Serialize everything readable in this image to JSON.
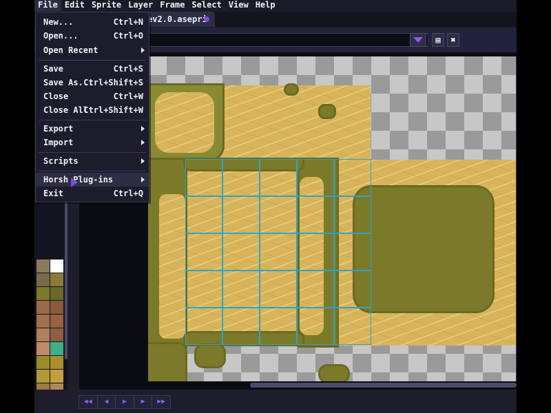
{
  "menubar": {
    "items": [
      "File",
      "Edit",
      "Sprite",
      "Layer",
      "Frame",
      "Select",
      "View",
      "Help"
    ]
  },
  "tab": {
    "title": "ev2.0.asepri"
  },
  "file_menu": {
    "items": [
      {
        "label": "New...",
        "shortcut": "Ctrl+N"
      },
      {
        "label": "Open...",
        "shortcut": "Ctrl+O"
      },
      {
        "label": "Open Recent",
        "submenu": true
      },
      {
        "label": "Save",
        "shortcut": "Ctrl+S"
      },
      {
        "label": "Save As...",
        "shortcut": "Ctrl+Shift+S"
      },
      {
        "label": "Close",
        "shortcut": "Ctrl+W"
      },
      {
        "label": "Close All",
        "shortcut": "Ctrl+Shift+W"
      },
      {
        "label": "Export",
        "submenu": true
      },
      {
        "label": "Import",
        "submenu": true
      },
      {
        "label": "Scripts",
        "submenu": true
      },
      {
        "label": "Horsh Plug-ins",
        "submenu": true
      },
      {
        "label": "Exit",
        "shortcut": "Ctrl+Q"
      }
    ]
  },
  "colors": {
    "accent": "#7a4cd8",
    "grid": "#2fa3c9",
    "sand": "#d8b45a",
    "grass": "#7a7a2a"
  },
  "palette": [
    "#8a7a5a",
    "#ffffff",
    "#7a6a4a",
    "#8a7a3a",
    "#7a7a2a",
    "#6a6a28",
    "#9a6a4a",
    "#8a5a3a",
    "#a07050",
    "#9a6040",
    "#b08060",
    "#8a6040",
    "#c08a6a",
    "#3fae8a",
    "#9a8a2a",
    "#a89030",
    "#b09838",
    "#c0a040",
    "#a07848",
    "#b08858",
    "#c0a060",
    "#d0b070"
  ],
  "timeline": {
    "buttons": [
      "first-frame-icon",
      "previous-frame-icon",
      "play-icon",
      "next-frame-icon",
      "last-frame-icon"
    ]
  }
}
